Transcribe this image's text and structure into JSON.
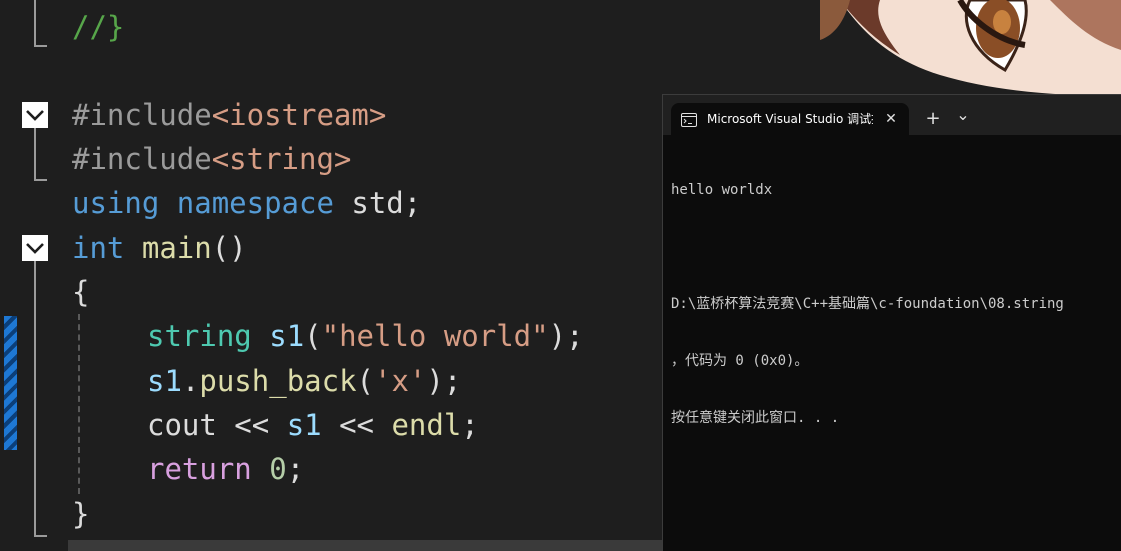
{
  "editor": {
    "lines": {
      "l1": {
        "comment": "//}"
      },
      "l3": {
        "directive": "#include",
        "header": "<iostream>"
      },
      "l4": {
        "directive": "#include",
        "header": "<string>"
      },
      "l5": {
        "kw_using": "using",
        "kw_namespace": "namespace",
        "name": "std",
        "semi": ";"
      },
      "l6": {
        "type": "int",
        "fn": "main",
        "parens": "()"
      },
      "l7": {
        "brace": "{"
      },
      "l8": {
        "type": "string",
        "var": "s1",
        "open": "(",
        "str": "\"hello world\"",
        "close": ");"
      },
      "l9": {
        "var": "s1",
        "dot": ".",
        "fn": "push_back",
        "open": "(",
        "chr": "'x'",
        "close": ");"
      },
      "l10": {
        "name": "cout",
        "op1": " << ",
        "var": "s1",
        "op2": " << ",
        "fn": "endl",
        "semi": ";"
      },
      "l11": {
        "kw": "return",
        "num": "0",
        "semi": ";"
      },
      "l12": {
        "brace": "}"
      }
    }
  },
  "terminal": {
    "tab_title": "Microsoft Visual Studio 调试控制台",
    "close_glyph": "✕",
    "new_tab_glyph": "+",
    "dropdown_glyph": "⌄",
    "output": {
      "line1": "hello worldx",
      "line2": "",
      "line3": "D:\\蓝桥杯算法竞赛\\C++基础篇\\c-foundation\\08.string",
      "line4": "，代码为 0 (0x0)。",
      "line5": "按任意键关闭此窗口. . ."
    }
  },
  "colors": {
    "editor_bg": "#1e1e1e",
    "keyword": "#569cd6",
    "control_keyword": "#d8a0df",
    "type": "#4ec9b0",
    "function": "#dcdcaa",
    "string": "#d69d85",
    "variable": "#9cdcfe",
    "number": "#b5cea8",
    "comment": "#57a64a",
    "terminal_bg": "#0c0c0c"
  },
  "icons": {
    "fold_toggle": "chevron-down-icon",
    "terminal_tab": "console-window-icon"
  }
}
